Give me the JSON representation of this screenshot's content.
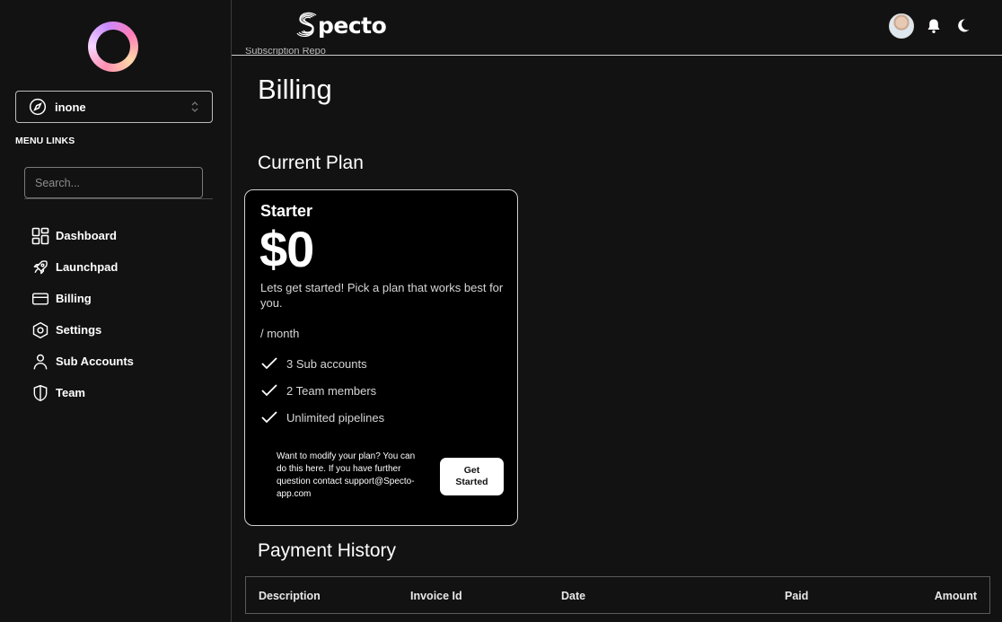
{
  "sidebar": {
    "account": {
      "name": "inone"
    },
    "menu_title": "MENU LINKS",
    "search": {
      "placeholder": "Search..."
    },
    "items": [
      {
        "label": "Dashboard",
        "icon": "dashboard-icon"
      },
      {
        "label": "Launchpad",
        "icon": "rocket-icon"
      },
      {
        "label": "Billing",
        "icon": "credit-card-icon"
      },
      {
        "label": "Settings",
        "icon": "settings-icon"
      },
      {
        "label": "Sub Accounts",
        "icon": "user-icon"
      },
      {
        "label": "Team",
        "icon": "shield-icon"
      }
    ]
  },
  "header": {
    "brand": "pecto",
    "icons": [
      "avatar",
      "bell-icon",
      "moon-icon"
    ]
  },
  "main": {
    "breadcrumb": "Subscription Repo",
    "title": "Billing",
    "current_plan_title": "Current Plan",
    "plan": {
      "name": "Starter",
      "price": "$0",
      "description": "Lets get started! Pick a plan that works best for you.",
      "period": "/ month",
      "features": [
        "3 Sub accounts",
        "2 Team members",
        "Unlimited pipelines"
      ],
      "note": "Want to modify your plan? You can do this here. If you have further question contact support@Specto-app.com",
      "button_label": "Get Started"
    },
    "payment_history_title": "Payment History",
    "table": {
      "columns": [
        "Description",
        "Invoice Id",
        "Date",
        "Paid",
        "Amount"
      ]
    }
  },
  "colors": {
    "background": "#121212",
    "card": "#000000",
    "border": "#cfcfcf"
  }
}
